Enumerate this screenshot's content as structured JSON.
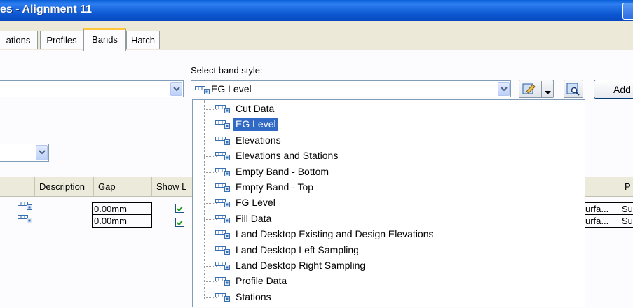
{
  "window": {
    "title": "es - Alignment 11"
  },
  "tabs": [
    {
      "label": "ations",
      "active": false
    },
    {
      "label": "Profiles",
      "active": false
    },
    {
      "label": "Bands",
      "active": true
    },
    {
      "label": "Hatch",
      "active": false
    }
  ],
  "band_style": {
    "label": "Select band style:",
    "selected": "EG Level",
    "add_label": "Add"
  },
  "table": {
    "headers": [
      "Description",
      "Gap",
      "Show L",
      "P"
    ],
    "rows": [
      {
        "gap": "0.00mm",
        "show": true,
        "source": "urfa...",
        "src2": "Su"
      },
      {
        "gap": "0.00mm",
        "show": true,
        "source": "urfa...",
        "src2": "Su"
      }
    ]
  },
  "dropdown_items": [
    "Cut Data",
    "EG Level",
    "Elevations",
    "Elevations and Stations",
    "Empty Band - Bottom",
    "Empty Band - Top",
    "FG Level",
    "Fill Data",
    "Land Desktop Existing and Design Elevations",
    "Land Desktop Left Sampling",
    "Land Desktop Right Sampling",
    "Profile Data",
    "Stations"
  ],
  "dropdown_selected_index": 1,
  "colors": {
    "titlebar": "#0a5fd8",
    "selection": "#316ac5",
    "tab_highlight": "#ffc83c"
  }
}
